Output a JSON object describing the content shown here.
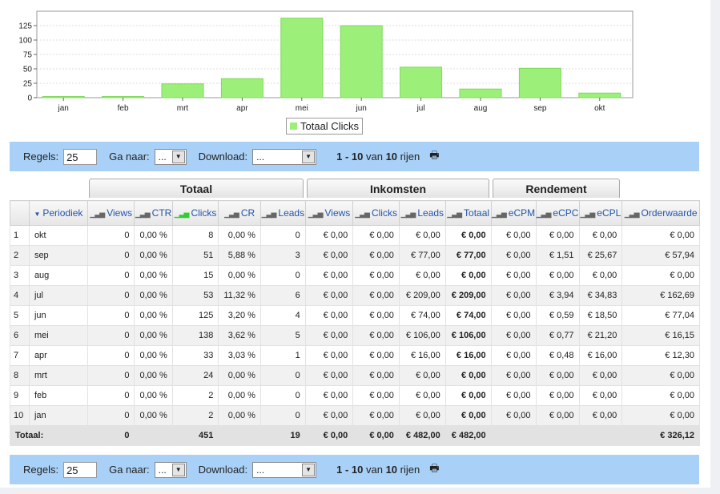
{
  "chart_data": {
    "type": "bar",
    "categories": [
      "jan",
      "feb",
      "mrt",
      "apr",
      "mei",
      "jun",
      "jul",
      "aug",
      "sep",
      "okt"
    ],
    "series": [
      {
        "name": "Totaal Clicks",
        "values": [
          2,
          2,
          24,
          33,
          138,
          125,
          53,
          15,
          51,
          8
        ],
        "color": "#9cf07a"
      }
    ],
    "yticks": [
      0,
      25,
      50,
      75,
      100,
      125
    ],
    "ylim": [
      0,
      150
    ],
    "grid": true,
    "legend": "bottom"
  },
  "toolbar": {
    "rows_label": "Regels:",
    "rows_value": "25",
    "goto_label": "Ga naar:",
    "goto_value": "...",
    "download_label": "Download:",
    "download_value": "...",
    "pag_range": "1 - 10",
    "pag_of": "van",
    "pag_total": "10",
    "pag_unit": "rijen",
    "print_icon": "printer-icon"
  },
  "groups": {
    "totaal": "Totaal",
    "inkomsten": "Inkomsten",
    "rendement": "Rendement"
  },
  "columns": [
    "Periodiek",
    "Views",
    "CTR",
    "Clicks",
    "CR",
    "Leads",
    "Views",
    "Clicks",
    "Leads",
    "Totaal",
    "eCPM",
    "eCPC",
    "eCPL",
    "Orderwaarde"
  ],
  "rows": [
    [
      "1",
      "okt",
      "0",
      "0,00 %",
      "8",
      "0,00 %",
      "0",
      "€ 0,00",
      "€ 0,00",
      "€ 0,00",
      "€ 0,00",
      "€ 0,00",
      "€ 0,00",
      "€ 0,00",
      "€ 0,00"
    ],
    [
      "2",
      "sep",
      "0",
      "0,00 %",
      "51",
      "5,88 %",
      "3",
      "€ 0,00",
      "€ 0,00",
      "€ 77,00",
      "€ 77,00",
      "€ 0,00",
      "€ 1,51",
      "€ 25,67",
      "€ 57,94"
    ],
    [
      "3",
      "aug",
      "0",
      "0,00 %",
      "15",
      "0,00 %",
      "0",
      "€ 0,00",
      "€ 0,00",
      "€ 0,00",
      "€ 0,00",
      "€ 0,00",
      "€ 0,00",
      "€ 0,00",
      "€ 0,00"
    ],
    [
      "4",
      "jul",
      "0",
      "0,00 %",
      "53",
      "11,32 %",
      "6",
      "€ 0,00",
      "€ 0,00",
      "€ 209,00",
      "€ 209,00",
      "€ 0,00",
      "€ 3,94",
      "€ 34,83",
      "€ 162,69"
    ],
    [
      "5",
      "jun",
      "0",
      "0,00 %",
      "125",
      "3,20 %",
      "4",
      "€ 0,00",
      "€ 0,00",
      "€ 74,00",
      "€ 74,00",
      "€ 0,00",
      "€ 0,59",
      "€ 18,50",
      "€ 77,04"
    ],
    [
      "6",
      "mei",
      "0",
      "0,00 %",
      "138",
      "3,62 %",
      "5",
      "€ 0,00",
      "€ 0,00",
      "€ 106,00",
      "€ 106,00",
      "€ 0,00",
      "€ 0,77",
      "€ 21,20",
      "€ 16,15"
    ],
    [
      "7",
      "apr",
      "0",
      "0,00 %",
      "33",
      "3,03 %",
      "1",
      "€ 0,00",
      "€ 0,00",
      "€ 16,00",
      "€ 16,00",
      "€ 0,00",
      "€ 0,48",
      "€ 16,00",
      "€ 12,30"
    ],
    [
      "8",
      "mrt",
      "0",
      "0,00 %",
      "24",
      "0,00 %",
      "0",
      "€ 0,00",
      "€ 0,00",
      "€ 0,00",
      "€ 0,00",
      "€ 0,00",
      "€ 0,00",
      "€ 0,00",
      "€ 0,00"
    ],
    [
      "9",
      "feb",
      "0",
      "0,00 %",
      "2",
      "0,00 %",
      "0",
      "€ 0,00",
      "€ 0,00",
      "€ 0,00",
      "€ 0,00",
      "€ 0,00",
      "€ 0,00",
      "€ 0,00",
      "€ 0,00"
    ],
    [
      "10",
      "jan",
      "0",
      "0,00 %",
      "2",
      "0,00 %",
      "0",
      "€ 0,00",
      "€ 0,00",
      "€ 0,00",
      "€ 0,00",
      "€ 0,00",
      "€ 0,00",
      "€ 0,00",
      "€ 0,00"
    ]
  ],
  "totals": [
    "Totaal:",
    "0",
    "",
    "451",
    "",
    "19",
    "€ 0,00",
    "€ 0,00",
    "€ 482,00",
    "€ 482,00",
    "",
    "",
    "",
    "€ 326,12"
  ]
}
